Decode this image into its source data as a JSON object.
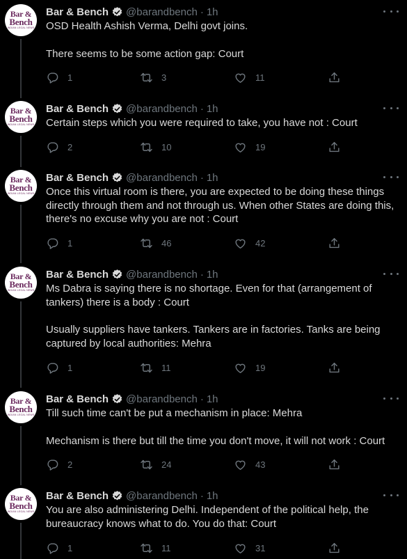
{
  "account": {
    "name": "Bar & Bench",
    "handle": "@barandbench",
    "separator": "·",
    "avatar": {
      "line1": "Bar &",
      "line2": "Bench",
      "line3": "INDIAN LEGAL NEWS"
    }
  },
  "colors": {
    "background": "#000000",
    "text": "#d9d9d9",
    "muted": "#6e767d",
    "verified": "#d9d9d9",
    "line": "#333639"
  },
  "tweets": [
    {
      "time": "1h",
      "paragraphs": [
        "OSD Health Ashish Verma, Delhi govt joins.",
        "There seems to be some action gap: Court"
      ],
      "replies": "1",
      "retweets": "3",
      "likes": "11"
    },
    {
      "time": "1h",
      "paragraphs": [
        "Certain steps which you were required to take, you have not : Court"
      ],
      "replies": "2",
      "retweets": "10",
      "likes": "19"
    },
    {
      "time": "1h",
      "paragraphs": [
        "Once this virtual room is there, you are expected to be doing these things directly through them and not through us. When other States are doing this, there's no excuse why you are not : Court"
      ],
      "replies": "1",
      "retweets": "46",
      "likes": "42"
    },
    {
      "time": "1h",
      "paragraphs": [
        "Ms Dabra is saying there is no shortage. Even for that (arrangement of tankers) there is a body : Court",
        "Usually suppliers have tankers. Tankers are in factories. Tanks are being captured by local authorities: Mehra"
      ],
      "replies": "1",
      "retweets": "11",
      "likes": "19"
    },
    {
      "time": "1h",
      "paragraphs": [
        "Till such time can't be put a mechanism in place: Mehra",
        "Mechanism is there but till the time you don't move, it will not work : Court"
      ],
      "replies": "2",
      "retweets": "24",
      "likes": "43"
    },
    {
      "time": "1h",
      "paragraphs": [
        "You are also administering Delhi. Independent of the political help, the bureaucracy knows what to do. You do that: Court"
      ],
      "replies": "1",
      "retweets": "11",
      "likes": "31"
    }
  ]
}
